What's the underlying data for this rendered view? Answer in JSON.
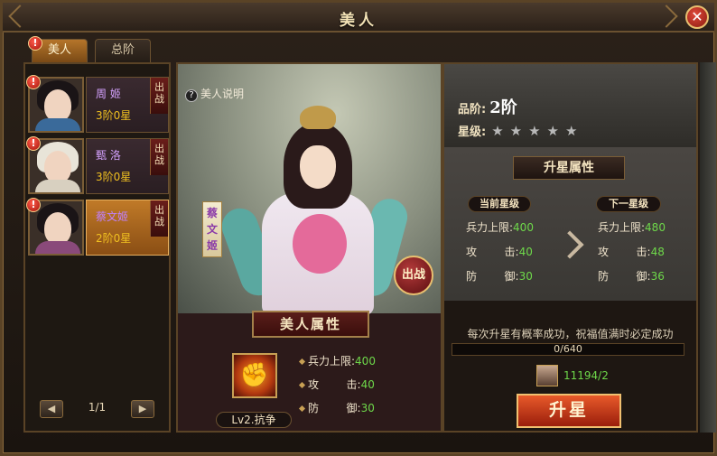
{
  "window": {
    "title": "美人",
    "close_glyph": "✕"
  },
  "tabs": [
    {
      "label": "美人",
      "active": true,
      "alert": "!"
    },
    {
      "label": "总阶",
      "active": false
    }
  ],
  "beauties": [
    {
      "name": "周 姬",
      "rank": "3阶0星",
      "deploy_label": "出战",
      "alert": "!",
      "selected": false,
      "robe_color": "#3a6a9a"
    },
    {
      "name": "甄 洛",
      "rank": "3阶0星",
      "deploy_label": "出战",
      "alert": "!",
      "selected": false,
      "robe_color": "#d8d0c0"
    },
    {
      "name": "蔡文姬",
      "rank": "2阶0星",
      "deploy_label": "出战",
      "alert": "!",
      "selected": true,
      "robe_color": "#8a4a7a"
    }
  ],
  "pager": {
    "prev": "◀",
    "page": "1/1",
    "next": "▶"
  },
  "detail": {
    "help_icon": "?",
    "help_label": "美人说明",
    "nameplate": "蔡文姬",
    "deploy_button": "出战",
    "attr_title": "美人属性",
    "skill_glyph": "✊",
    "skill_label": "Lv2.抗争",
    "stats": [
      {
        "label": "兵力上限:",
        "value": "400"
      },
      {
        "label": "攻        击:",
        "value": "40"
      },
      {
        "label": "防        御:",
        "value": "30"
      }
    ]
  },
  "upgrade": {
    "grade_label": "品阶:",
    "grade_value": "2阶",
    "star_label": "星级:",
    "stars": "★★★★★",
    "title": "升星属性",
    "current_label": "当前星级",
    "next_label": "下一星级",
    "current_stats": [
      {
        "label": "兵力上限:",
        "value": "400"
      },
      {
        "label": "攻        击:",
        "value": "40"
      },
      {
        "label": "防        御:",
        "value": "30"
      }
    ],
    "next_stats": [
      {
        "label": "兵力上限:",
        "value": "480"
      },
      {
        "label": "攻        击:",
        "value": "48"
      },
      {
        "label": "防        御:",
        "value": "36"
      }
    ],
    "note": "每次升星有概率成功，祝福值满时必定成功",
    "progress_text": "0/640",
    "progress_fraction": 0,
    "cost_text": "11194/2",
    "button_label": "升星"
  },
  "colors": {
    "accent": "#c8a054",
    "stat_value": "#6ed84a",
    "name_purple": "#d5a2ff",
    "rank_yellow": "#f0c020"
  }
}
